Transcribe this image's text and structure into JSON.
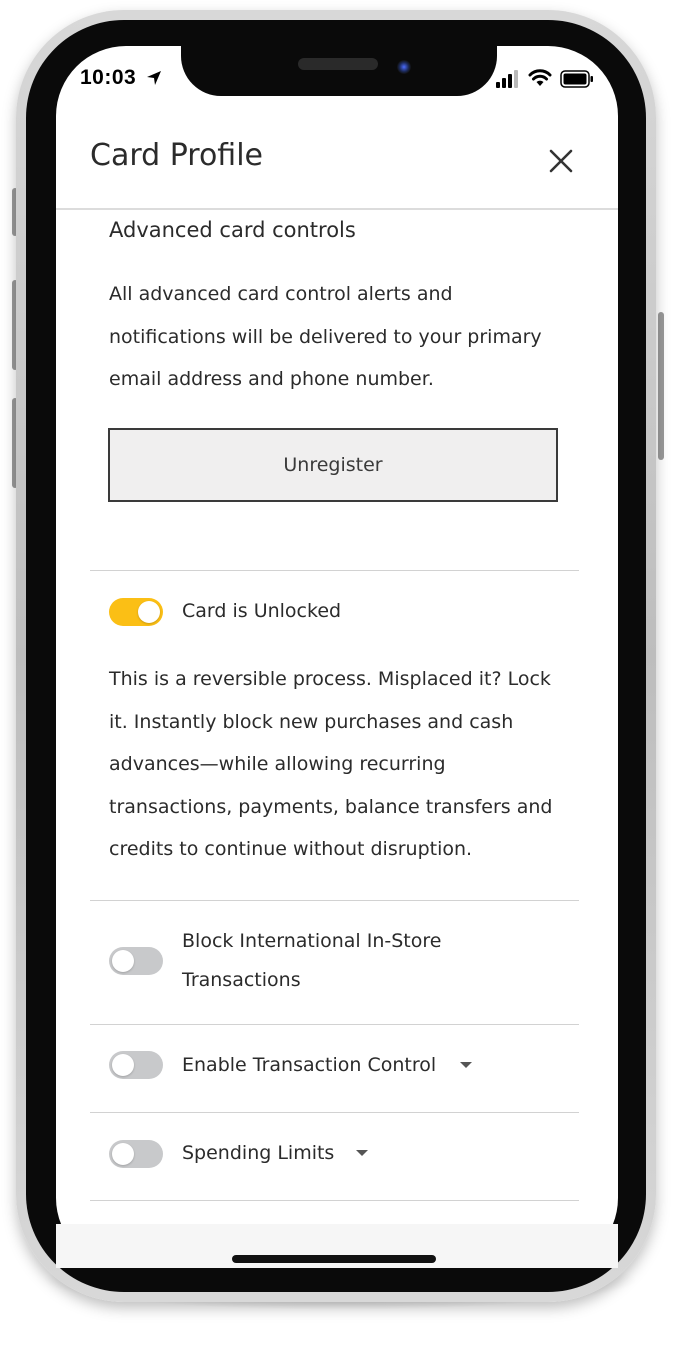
{
  "status_bar": {
    "time": "10:03",
    "icons": [
      "location-arrow-icon",
      "cellular-signal-icon",
      "wifi-icon",
      "battery-icon"
    ]
  },
  "header": {
    "title": "Card Profile",
    "close_icon": "close-icon"
  },
  "advanced_controls": {
    "heading": "Advanced card controls",
    "description": "All advanced card control alerts and notifications will be delivered to your primary email address and phone number.",
    "unregister_label": "Unregister"
  },
  "lock": {
    "toggle_state": "on",
    "label": "Card is Unlocked",
    "description": "This is a reversible process. Misplaced it? Lock it. Instantly block new purchases and cash advances—while allowing recurring transactions, payments, balance transfers and credits to continue without disruption."
  },
  "controls": [
    {
      "label_line1": "Block International In-Store",
      "label_line2": "Transactions",
      "toggle_state": "off"
    },
    {
      "label": "Enable Transaction Control",
      "toggle_state": "off",
      "has_dropdown": true
    },
    {
      "label": "Spending Limits",
      "toggle_state": "off",
      "has_dropdown": true
    }
  ],
  "colors": {
    "toggle_on": "#fbbf15",
    "toggle_off": "#c8c9cb",
    "text": "#2b2b2b"
  }
}
